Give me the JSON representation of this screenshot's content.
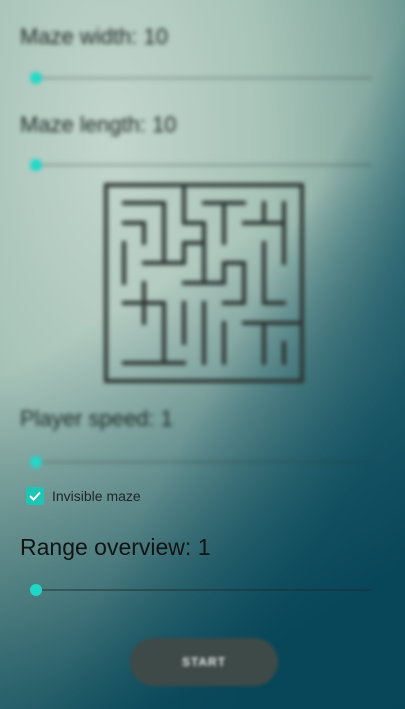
{
  "settings": {
    "maze_width_label": "Maze width: 10",
    "maze_width_value": 10,
    "maze_length_label": "Maze length: 10",
    "maze_length_value": 10,
    "player_speed_label": "Player speed: 1",
    "player_speed_value": 1,
    "invisible_maze_label": "Invisible maze",
    "invisible_maze_checked": true,
    "range_overview_label": "Range overview: 1",
    "range_overview_value": 1,
    "start_label": "START"
  },
  "colors": {
    "accent": "#1fd7c8",
    "button": "#3e4a48"
  },
  "icons": {
    "maze_preview": "maze-icon",
    "checkbox": "check-icon"
  }
}
